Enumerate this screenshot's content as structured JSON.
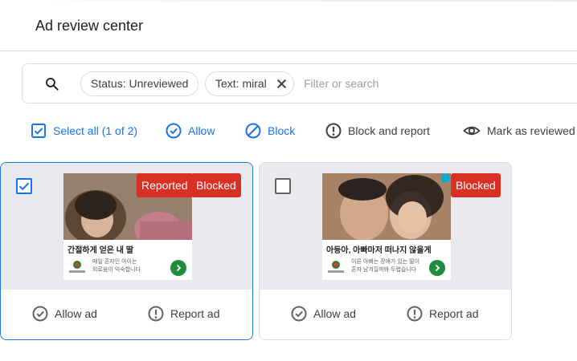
{
  "header": {
    "title": "Ad review center"
  },
  "filters": {
    "chips": [
      {
        "label": "Status: Unreviewed",
        "removable": false
      },
      {
        "label": "Text: miral",
        "removable": true
      }
    ],
    "placeholder": "Filter or search",
    "value": ""
  },
  "toolbar": {
    "select_all": "Select all (1 of 2)",
    "allow": "Allow",
    "block": "Block",
    "block_and_report": "Block and report",
    "mark_reviewed": "Mark as reviewed"
  },
  "colors": {
    "accent": "#1a73e8",
    "badge_red": "#d93025",
    "cta_green": "#1e8e3e"
  },
  "ads": [
    {
      "selected": true,
      "badges": [
        "Reported",
        "Blocked"
      ],
      "headline": "간절하게 얻은 내 딸",
      "body": "매일 혼자인 아이는\n외로움이 익숙합니다.",
      "footer": {
        "allow": "Allow ad",
        "report": "Report ad"
      }
    },
    {
      "selected": false,
      "badges": [
        "Blocked"
      ],
      "headline": "아등아, 아빠마저 떠나지 않을게",
      "body": "이른 아빠는 장애가 있는 딸이\n혼자 남겨질까봐 두렵습니다",
      "footer": {
        "allow": "Allow ad",
        "report": "Report ad"
      }
    }
  ]
}
